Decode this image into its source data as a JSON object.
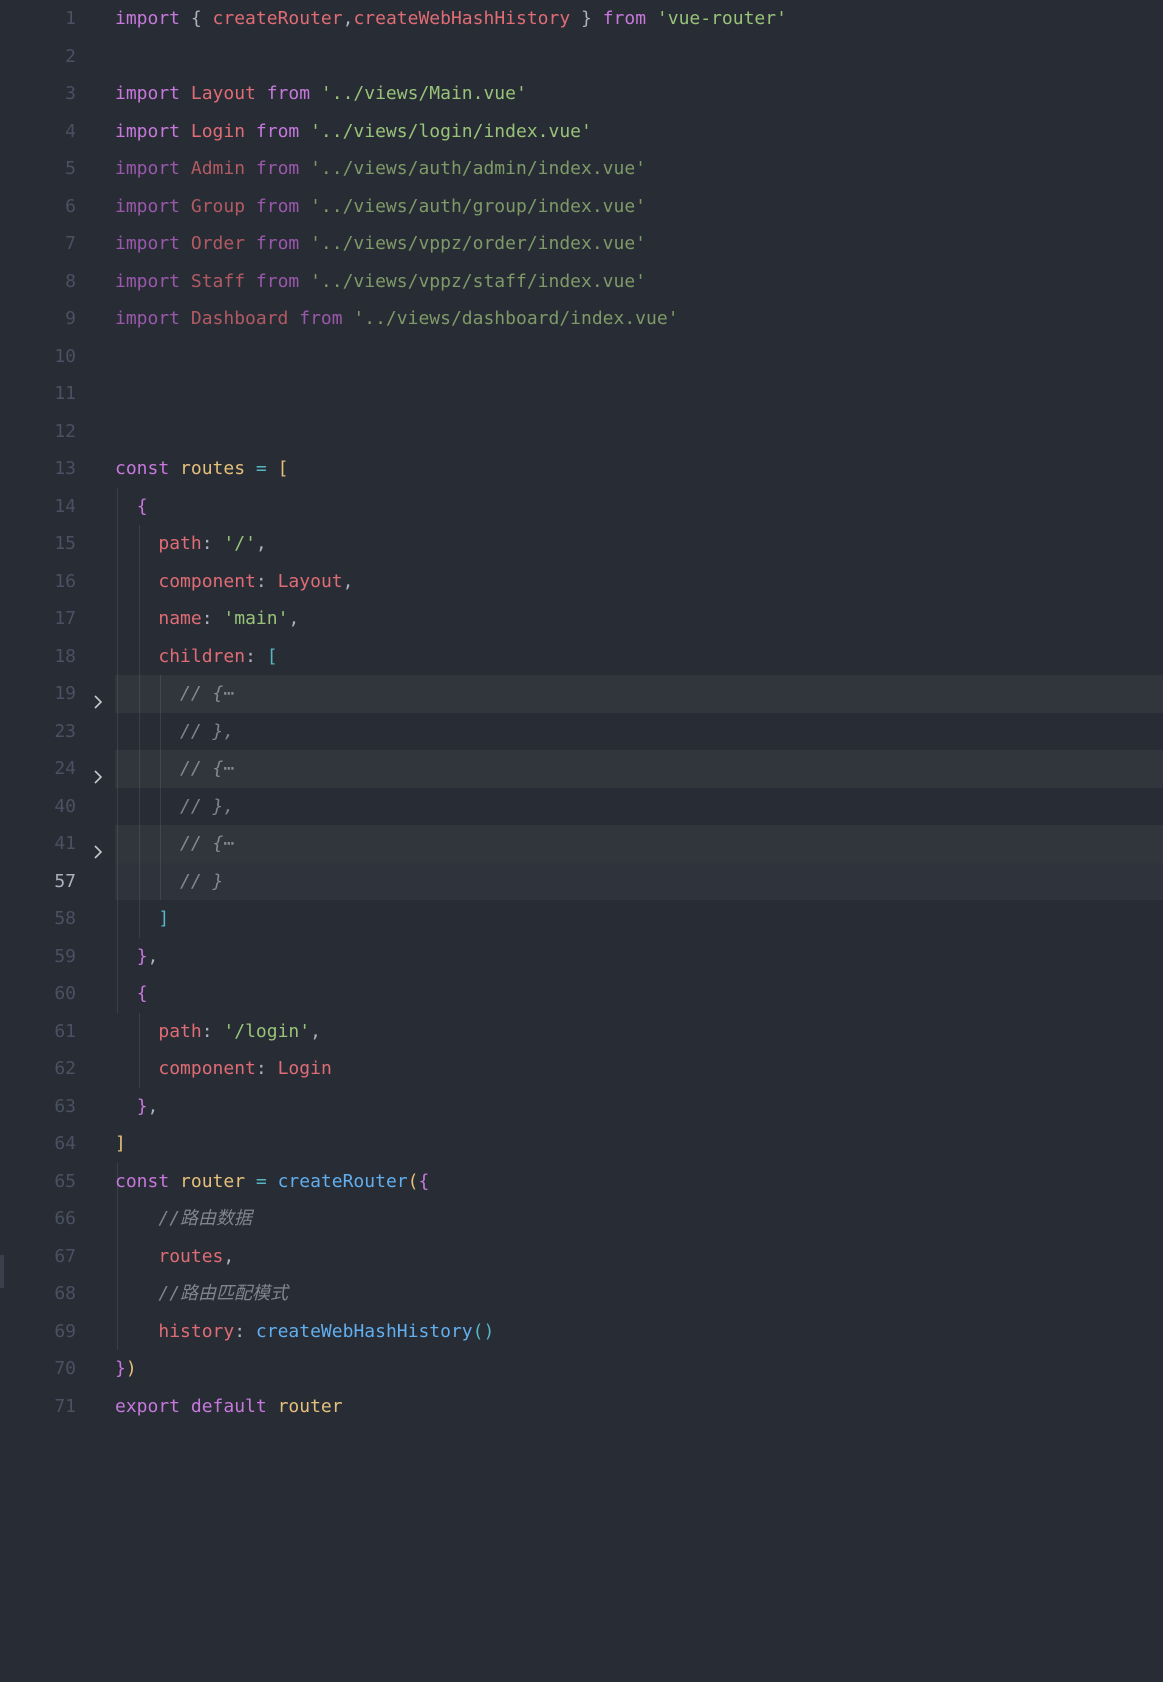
{
  "editor": {
    "language": "javascript",
    "theme_colors": {
      "background": "#282c34",
      "keyword": "#c678dd",
      "variable": "#e06c75",
      "string": "#98c379",
      "function": "#61afef",
      "constant": "#e5c07b",
      "operator": "#56b6c2",
      "comment": "#7f848e",
      "line_number": "#495162"
    },
    "current_line_number": "57",
    "lines": [
      {
        "n": "1",
        "tokens": [
          [
            "k",
            "import "
          ],
          [
            "d",
            "{ "
          ],
          [
            "v",
            "createRouter"
          ],
          [
            "d",
            ","
          ],
          [
            "v",
            "createWebHashHistory"
          ],
          [
            "d",
            " } "
          ],
          [
            "k",
            "from "
          ],
          [
            "s",
            "'vue-router'"
          ]
        ]
      },
      {
        "n": "2",
        "tokens": []
      },
      {
        "n": "3",
        "tokens": [
          [
            "k",
            "import "
          ],
          [
            "v",
            "Layout "
          ],
          [
            "k",
            "from "
          ],
          [
            "s",
            "'../views/Main.vue'"
          ]
        ]
      },
      {
        "n": "4",
        "tokens": [
          [
            "k",
            "import "
          ],
          [
            "v",
            "Login "
          ],
          [
            "k",
            "from "
          ],
          [
            "s",
            "'../views/login/index.vue'"
          ]
        ]
      },
      {
        "n": "5",
        "tokens": [
          [
            "kd",
            "import "
          ],
          [
            "vd",
            "Admin "
          ],
          [
            "kd",
            "from "
          ],
          [
            "sd",
            "'../views/auth/admin/index.vue'"
          ]
        ]
      },
      {
        "n": "6",
        "tokens": [
          [
            "kd",
            "import "
          ],
          [
            "vd",
            "Group "
          ],
          [
            "kd",
            "from "
          ],
          [
            "sd",
            "'../views/auth/group/index.vue'"
          ]
        ]
      },
      {
        "n": "7",
        "tokens": [
          [
            "kd",
            "import "
          ],
          [
            "vd",
            "Order "
          ],
          [
            "kd",
            "from "
          ],
          [
            "sd",
            "'../views/vppz/order/index.vue'"
          ]
        ]
      },
      {
        "n": "8",
        "tokens": [
          [
            "kd",
            "import "
          ],
          [
            "vd",
            "Staff "
          ],
          [
            "kd",
            "from "
          ],
          [
            "sd",
            "'../views/vppz/staff/index.vue'"
          ]
        ]
      },
      {
        "n": "9",
        "tokens": [
          [
            "kd",
            "import "
          ],
          [
            "vd",
            "Dashboard "
          ],
          [
            "kd",
            "from "
          ],
          [
            "sd",
            "'../views/dashboard/index.vue'"
          ]
        ]
      },
      {
        "n": "10",
        "tokens": []
      },
      {
        "n": "11",
        "tokens": []
      },
      {
        "n": "12",
        "tokens": []
      },
      {
        "n": "13",
        "tokens": [
          [
            "k",
            "const "
          ],
          [
            "y",
            "routes "
          ],
          [
            "o",
            "= "
          ],
          [
            "b1",
            "["
          ]
        ]
      },
      {
        "n": "14",
        "tokens": [
          [
            "d",
            "  "
          ],
          [
            "b2",
            "{"
          ]
        ]
      },
      {
        "n": "15",
        "tokens": [
          [
            "d",
            "    "
          ],
          [
            "v",
            "path"
          ],
          [
            "d",
            ": "
          ],
          [
            "s",
            "'/'"
          ],
          [
            "d",
            ","
          ]
        ]
      },
      {
        "n": "16",
        "tokens": [
          [
            "d",
            "    "
          ],
          [
            "v",
            "component"
          ],
          [
            "d",
            ": "
          ],
          [
            "v",
            "Layout"
          ],
          [
            "d",
            ","
          ]
        ]
      },
      {
        "n": "17",
        "tokens": [
          [
            "d",
            "    "
          ],
          [
            "v",
            "name"
          ],
          [
            "d",
            ": "
          ],
          [
            "s",
            "'main'"
          ],
          [
            "d",
            ","
          ]
        ]
      },
      {
        "n": "18",
        "tokens": [
          [
            "d",
            "    "
          ],
          [
            "v",
            "children"
          ],
          [
            "d",
            ": "
          ],
          [
            "b3",
            "["
          ]
        ]
      },
      {
        "n": "19",
        "fold": true,
        "tokens": [
          [
            "d",
            "      "
          ],
          [
            "c",
            "// {"
          ],
          [
            "c",
            "⋯"
          ]
        ]
      },
      {
        "n": "23",
        "tokens": [
          [
            "d",
            "      "
          ],
          [
            "c",
            "// },"
          ]
        ]
      },
      {
        "n": "24",
        "fold": true,
        "tokens": [
          [
            "d",
            "      "
          ],
          [
            "c",
            "// {"
          ],
          [
            "c",
            "⋯"
          ]
        ]
      },
      {
        "n": "40",
        "tokens": [
          [
            "d",
            "      "
          ],
          [
            "c",
            "// },"
          ]
        ]
      },
      {
        "n": "41",
        "fold": true,
        "tokens": [
          [
            "d",
            "      "
          ],
          [
            "c",
            "// {"
          ],
          [
            "c",
            "⋯"
          ]
        ]
      },
      {
        "n": "57",
        "current": true,
        "tokens": [
          [
            "d",
            "      "
          ],
          [
            "c",
            "// }"
          ]
        ]
      },
      {
        "n": "58",
        "tokens": [
          [
            "d",
            "    "
          ],
          [
            "b3",
            "]"
          ]
        ]
      },
      {
        "n": "59",
        "tokens": [
          [
            "d",
            "  "
          ],
          [
            "b2",
            "}"
          ],
          [
            "d",
            ","
          ]
        ]
      },
      {
        "n": "60",
        "tokens": [
          [
            "d",
            "  "
          ],
          [
            "b2",
            "{"
          ]
        ]
      },
      {
        "n": "61",
        "tokens": [
          [
            "d",
            "    "
          ],
          [
            "v",
            "path"
          ],
          [
            "d",
            ": "
          ],
          [
            "s",
            "'/login'"
          ],
          [
            "d",
            ","
          ]
        ]
      },
      {
        "n": "62",
        "tokens": [
          [
            "d",
            "    "
          ],
          [
            "v",
            "component"
          ],
          [
            "d",
            ": "
          ],
          [
            "v",
            "Login"
          ]
        ]
      },
      {
        "n": "63",
        "tokens": [
          [
            "d",
            "  "
          ],
          [
            "b2",
            "}"
          ],
          [
            "d",
            ","
          ]
        ]
      },
      {
        "n": "64",
        "tokens": [
          [
            "b1",
            "]"
          ]
        ]
      },
      {
        "n": "65",
        "tokens": [
          [
            "k",
            "const "
          ],
          [
            "y",
            "router "
          ],
          [
            "o",
            "= "
          ],
          [
            "f",
            "createRouter"
          ],
          [
            "b1",
            "("
          ],
          [
            "b2",
            "{"
          ]
        ]
      },
      {
        "n": "66",
        "tokens": [
          [
            "d",
            "    "
          ],
          [
            "c",
            "//路由数据"
          ]
        ]
      },
      {
        "n": "67",
        "tokens": [
          [
            "d",
            "    "
          ],
          [
            "v",
            "routes"
          ],
          [
            "d",
            ","
          ]
        ]
      },
      {
        "n": "68",
        "tokens": [
          [
            "d",
            "    "
          ],
          [
            "c",
            "//路由匹配模式"
          ]
        ]
      },
      {
        "n": "69",
        "tokens": [
          [
            "d",
            "    "
          ],
          [
            "v",
            "history"
          ],
          [
            "d",
            ": "
          ],
          [
            "f",
            "createWebHashHistory"
          ],
          [
            "b3",
            "()"
          ]
        ]
      },
      {
        "n": "70",
        "tokens": [
          [
            "b2",
            "}"
          ],
          [
            "b1",
            ")"
          ]
        ]
      },
      {
        "n": "71",
        "tokens": [
          [
            "k",
            "export "
          ],
          [
            "k",
            "default "
          ],
          [
            "y",
            "router"
          ]
        ]
      }
    ]
  }
}
